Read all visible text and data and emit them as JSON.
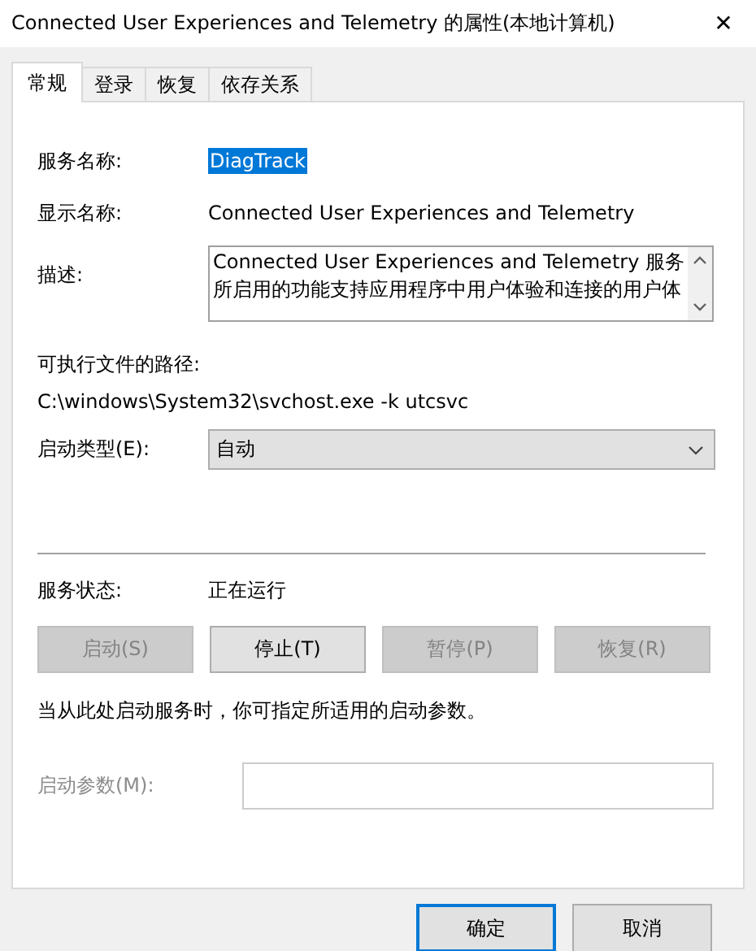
{
  "window": {
    "title": "Connected User Experiences and Telemetry 的属性(本地计算机)",
    "close": "✕"
  },
  "tabs": [
    {
      "label": "常规",
      "selected": true
    },
    {
      "label": "登录",
      "selected": false
    },
    {
      "label": "恢复",
      "selected": false
    },
    {
      "label": "依存关系",
      "selected": false
    }
  ],
  "service_name": {
    "label": "服务名称:",
    "value": "DiagTrack",
    "selected": true
  },
  "display_name": {
    "label": "显示名称:",
    "value": "Connected User Experiences and Telemetry"
  },
  "description": {
    "label": "描述:",
    "value": "Connected User Experiences and Telemetry 服务所启用的功能支持应用程序中用户体验和连接的用户体"
  },
  "executable_path": {
    "label": "可执行文件的路径:",
    "value": "C:\\windows\\System32\\svchost.exe -k utcsvc"
  },
  "startup_type": {
    "label": "启动类型(E):",
    "value": "自动"
  },
  "service_status": {
    "label": "服务状态:",
    "value": "正在运行"
  },
  "service_buttons": [
    {
      "label": "启动(S)",
      "disabled": true
    },
    {
      "label": "停止(T)",
      "disabled": false
    },
    {
      "label": "暂停(P)",
      "disabled": true
    },
    {
      "label": "恢复(R)",
      "disabled": true
    }
  ],
  "hint": "当从此处启动服务时，你可指定所适用的启动参数。",
  "start_parameters": {
    "label": "启动参数(M):",
    "disabled": true
  },
  "dialog_buttons": [
    {
      "label": "确定",
      "default": true
    },
    {
      "label": "取消",
      "default": false
    }
  ]
}
